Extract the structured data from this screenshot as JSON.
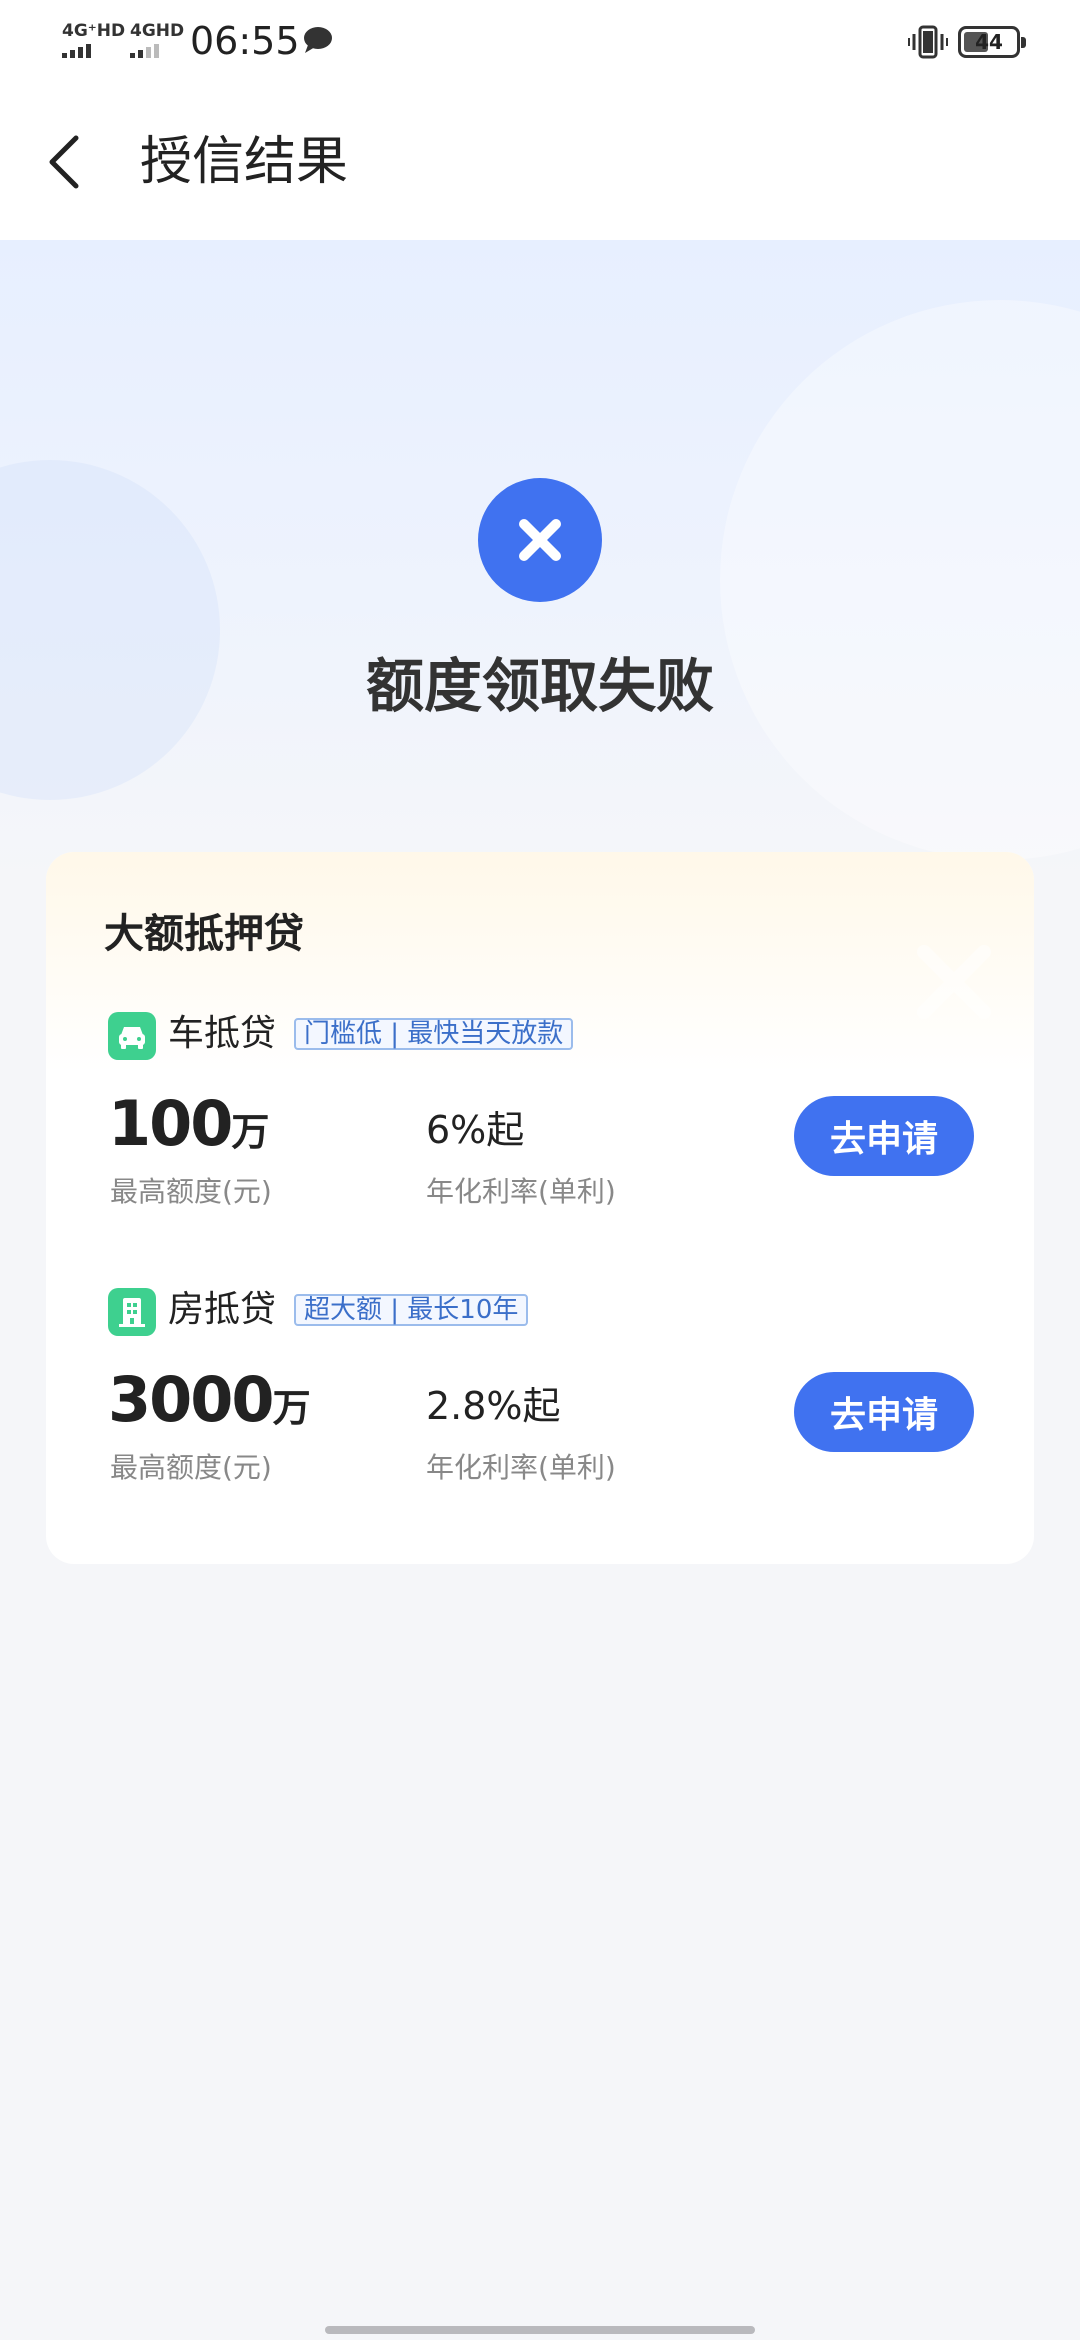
{
  "status_bar": {
    "net1": "4G⁺HD",
    "net2": "4GHD",
    "time": "06:55",
    "battery": "44"
  },
  "header": {
    "title": "授信结果"
  },
  "result": {
    "title": "额度领取失败"
  },
  "card": {
    "title": "大额抵押贷",
    "loans": [
      {
        "name": "车抵贷",
        "tag": "门槛低 | 最快当天放款",
        "amount": "100",
        "amount_unit": "万",
        "amount_label": "最高额度(元)",
        "rate": "6%起",
        "rate_label": "年化利率(单利)",
        "button": "去申请",
        "icon": "car-icon"
      },
      {
        "name": "房抵贷",
        "tag": "超大额 | 最长10年",
        "amount": "3000",
        "amount_unit": "万",
        "amount_label": "最高额度(元)",
        "rate": "2.8%起",
        "rate_label": "年化利率(单利)",
        "button": "去申请",
        "icon": "building-icon"
      }
    ]
  },
  "colors": {
    "primary": "#4072f0",
    "icon_green": "#3ed08f",
    "tag_text": "#3b6fc9"
  }
}
